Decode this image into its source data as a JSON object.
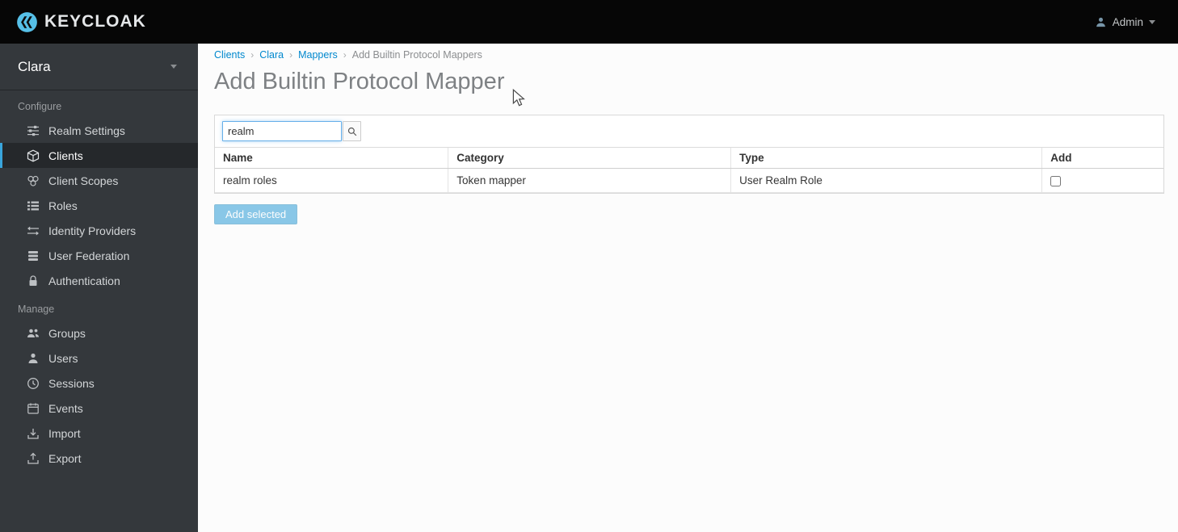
{
  "colors": {
    "accent": "#0088ce",
    "topbar_bg": "#060606",
    "sidebar_bg": "#34383c",
    "active_indicator": "#39a5dc",
    "logo_blue": "#56c0e8",
    "link_blue": "#0088ce"
  },
  "topbar": {
    "brand": "KEYCLOAK",
    "user_label": "Admin"
  },
  "sidebar": {
    "realm": "Clara",
    "sections": [
      {
        "label": "Configure",
        "items": [
          {
            "label": "Realm Settings",
            "icon": "sliders-icon",
            "active": false
          },
          {
            "label": "Clients",
            "icon": "cube-icon",
            "active": true
          },
          {
            "label": "Client Scopes",
            "icon": "scopes-icon",
            "active": false
          },
          {
            "label": "Roles",
            "icon": "list-icon",
            "active": false
          },
          {
            "label": "Identity Providers",
            "icon": "exchange-arrows-icon",
            "active": false
          },
          {
            "label": "User Federation",
            "icon": "database-icon",
            "active": false
          },
          {
            "label": "Authentication",
            "icon": "lock-icon",
            "active": false
          }
        ]
      },
      {
        "label": "Manage",
        "items": [
          {
            "label": "Groups",
            "icon": "group-icon",
            "active": false
          },
          {
            "label": "Users",
            "icon": "user-icon",
            "active": false
          },
          {
            "label": "Sessions",
            "icon": "clock-icon",
            "active": false
          },
          {
            "label": "Events",
            "icon": "calendar-icon",
            "active": false
          },
          {
            "label": "Import",
            "icon": "import-icon",
            "active": false
          },
          {
            "label": "Export",
            "icon": "export-icon",
            "active": false
          }
        ]
      }
    ]
  },
  "breadcrumb": [
    {
      "label": "Clients",
      "is_link": true
    },
    {
      "label": "Clara",
      "is_link": true
    },
    {
      "label": "Mappers",
      "is_link": true
    },
    {
      "label": "Add Builtin Protocol Mappers",
      "is_link": false
    }
  ],
  "main": {
    "title": "Add Builtin Protocol Mapper",
    "search": {
      "value": "realm"
    },
    "table": {
      "headers": [
        "Name",
        "Category",
        "Type",
        "Add"
      ],
      "rows": [
        {
          "name": "realm roles",
          "category": "Token mapper",
          "type": "User Realm Role",
          "checked": false
        }
      ]
    },
    "add_selected_label": "Add selected",
    "add_selected_enabled": false
  }
}
